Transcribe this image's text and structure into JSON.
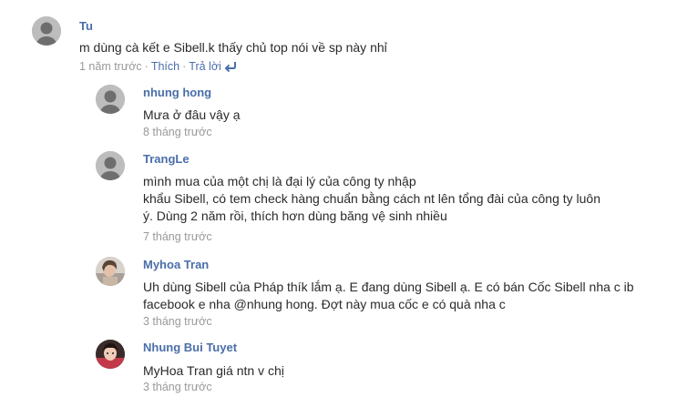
{
  "comments": [
    {
      "author": "Tu",
      "lines": [
        "m dùng cà kết e Sibell.k thấy chủ top nói về sp này nhỉ"
      ],
      "time": "1 năm trước",
      "like_label": "Thích",
      "reply_label": "Trả lời"
    }
  ],
  "replies": [
    {
      "author": "nhung hong",
      "lines": [
        "Mưa ở đâu vậy ạ"
      ],
      "time": "8 tháng trước"
    },
    {
      "author": "TrangLe",
      "lines": [
        "mình mua của một chị là đại lý của công ty nhập",
        "khẩu Sibell, có tem check hàng chuẩn bằng cách nt lên tổng đài của công ty luôn",
        "ý. Dùng 2 năm rồi, thích hơn dùng băng vệ sinh nhiều"
      ],
      "time": "7 tháng trước"
    },
    {
      "author": "Myhoa Tran",
      "lines": [
        "Uh dùng Sibell của Pháp thík lắm ạ. E đang dùng Sibell ạ. E có bán Cốc Sibell nha c  ib",
        "facebook e nha @nhung hong. Đợt này mua cốc e có quà nha c"
      ],
      "time": "3 tháng trước"
    },
    {
      "author": "Nhung Bui Tuyet",
      "lines": [
        "MyHoa Tran giá ntn v chị"
      ],
      "time": "3 tháng trước"
    }
  ],
  "icons": {
    "default_avatar": "default-avatar-icon",
    "reply": "reply-arrow-icon"
  },
  "colors": {
    "link": "#4a6ea9",
    "meta": "#999999",
    "text": "#2a2a2a",
    "avatar_bg": "#bdbdbd"
  }
}
